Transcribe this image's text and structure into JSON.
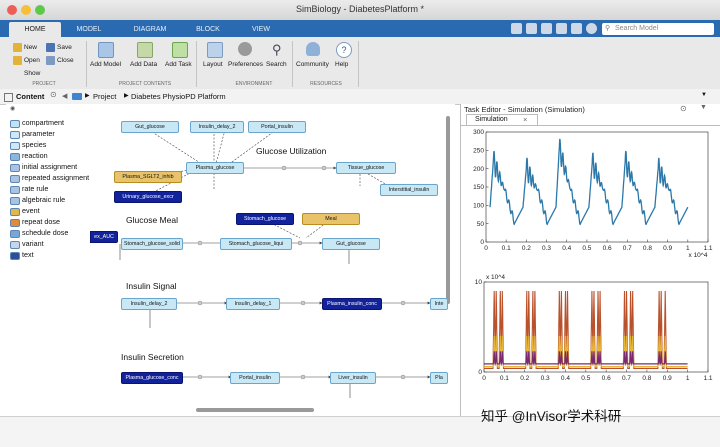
{
  "window": {
    "title": "SimBiology - DiabetesPlatform *"
  },
  "tabs": [
    {
      "label": "HOME",
      "active": true
    },
    {
      "label": "MODEL",
      "active": false
    },
    {
      "label": "DIAGRAM",
      "active": false
    },
    {
      "label": "BLOCK",
      "active": false
    },
    {
      "label": "VIEW",
      "active": false
    }
  ],
  "search": {
    "placeholder": "Search Model"
  },
  "toolstrip": {
    "project_buttons": [
      "New",
      "Save",
      "Open",
      "Close",
      "Show"
    ],
    "model_buttons": [
      "Add Model",
      "Add Data",
      "Add Task"
    ],
    "environment_buttons": [
      "Layout",
      "Preferences",
      "Search"
    ],
    "resources_buttons": [
      "Community",
      "Help"
    ],
    "groups": [
      "PROJECT",
      "PROJECT CONTENTS",
      "ENVIRONMENT",
      "RESOURCES"
    ]
  },
  "address": {
    "panel_title": "Content",
    "path": [
      "Project",
      "Diabetes PhysioPD Platform"
    ]
  },
  "library": {
    "items": [
      {
        "label": "compartment",
        "icon": "compartment-icon",
        "color": "#bfe3f3"
      },
      {
        "label": "parameter",
        "icon": "parameter-icon",
        "color": "#cfe8f7"
      },
      {
        "label": "species",
        "icon": "species-icon",
        "color": "#cfe8f7"
      },
      {
        "label": "reaction",
        "icon": "reaction-icon",
        "color": "#8ab7dd"
      },
      {
        "label": "initial assignment",
        "icon": "initial-assignment-icon",
        "color": "#a7c4e2"
      },
      {
        "label": "repeated assignment",
        "icon": "repeated-assignment-icon",
        "color": "#a7c4e2"
      },
      {
        "label": "rate rule",
        "icon": "rate-rule-icon",
        "color": "#a7c4e2"
      },
      {
        "label": "algebraic rule",
        "icon": "algebraic-rule-icon",
        "color": "#a7c4e2"
      },
      {
        "label": "event",
        "icon": "event-icon",
        "color": "#e0b84a"
      },
      {
        "label": "repeat dose",
        "icon": "repeat-dose-icon",
        "color": "#e08a3a"
      },
      {
        "label": "schedule dose",
        "icon": "schedule-dose-icon",
        "color": "#7ba6d4"
      },
      {
        "label": "variant",
        "icon": "variant-icon",
        "color": "#c6d6e8"
      },
      {
        "label": "text",
        "icon": "text-icon",
        "color": "#2a4f9a"
      }
    ]
  },
  "diagram": {
    "clusters": {
      "glucose_utilization": "Glucose Utilization",
      "glucose_meal": "Glucose Meal",
      "insulin_signal": "Insulin Signal",
      "insulin_secretion": "Insulin Secretion"
    },
    "nodes": {
      "gut_glucose_1": "Gut_glucose",
      "insulin_delay_2a": "Insulin_delay_2",
      "portal_insulin_1": "Portal_insulin",
      "plasma_glucose_1": "Plasma_glucose",
      "plasma_sglt2": "Plasma_SGLT2_inhib",
      "urinary_glucose": "Urinary_glucose_excr",
      "tissue_glucose": "Tissue_glucose",
      "interstitial_insulin": "Interstitial_insulin",
      "stomach_glucose": "Stomach_glucose",
      "meal": "Meal",
      "ex_auc": "ex_AUC",
      "stomach_solid": "Stomach_glucose_solid",
      "stomach_liquid": "Stomach_glucose_liqui",
      "gut_glucose_2": "Gut_glucose",
      "insulin_delay_2b": "Insulin_delay_2",
      "insulin_delay_1": "Insulin_delay_1",
      "plasma_insulin_conc": "Plasma_insulin_conc",
      "inte": "Inte",
      "plasma_glucose_conc": "Plasma_glucose_conc",
      "portal_insulin_2": "Portal_insulin",
      "liver_insulin": "Liver_insulin",
      "pla": "Pla"
    }
  },
  "task_editor": {
    "title": "Task Editor - Simulation (Simulation)",
    "tab": "Simulation"
  },
  "chart_data": [
    {
      "type": "line",
      "xlim": [
        0,
        1.1
      ],
      "x_multiplier": "x 10^4",
      "ylim": [
        0,
        300
      ],
      "xticks": [
        "0",
        "0.1",
        "0.2",
        "0.3",
        "0.4",
        "0.5",
        "0.6",
        "0.7",
        "0.8",
        "0.9",
        "1",
        "1.1"
      ],
      "yticks": [
        "0",
        "50",
        "100",
        "150",
        "200",
        "250",
        "300"
      ],
      "series": [
        {
          "color": "#2b78a9",
          "cycles": 6,
          "x_start": 0.02,
          "x_end": 1.0,
          "baseline": 95,
          "trough": 52,
          "peaks": [
            220,
            200,
            255,
            215
          ]
        }
      ]
    },
    {
      "type": "line",
      "xlim": [
        0,
        1.1
      ],
      "ylim": [
        0,
        10
      ],
      "y_multiplier": "x 10^4",
      "xticks": [
        "0",
        "0.1",
        "0.2",
        "0.3",
        "0.4",
        "0.5",
        "0.6",
        "0.7",
        "0.8",
        "0.9",
        "1",
        "1.1"
      ],
      "yticks": [
        "0",
        "10"
      ],
      "series": [
        {
          "color": "#b9512a",
          "spikes": [
            0.05,
            0.06,
            0.08,
            0.09,
            0.21,
            0.22,
            0.24,
            0.25,
            0.37,
            0.38,
            0.4,
            0.41,
            0.53,
            0.54,
            0.56,
            0.57,
            0.69,
            0.7,
            0.72,
            0.73,
            0.86,
            0.87,
            0.89
          ],
          "peak": 9.0,
          "base": 0.4
        },
        {
          "color": "#e7b43a",
          "spikes": [
            0.05,
            0.06,
            0.08,
            0.09,
            0.21,
            0.22,
            0.24,
            0.25,
            0.37,
            0.38,
            0.4,
            0.41,
            0.53,
            0.54,
            0.56,
            0.57,
            0.69,
            0.7,
            0.72,
            0.73,
            0.86,
            0.87,
            0.89
          ],
          "peak": 4.0,
          "base": 0.6
        },
        {
          "color": "#7a2a6e",
          "spikes": [
            0.05,
            0.06,
            0.08,
            0.09,
            0.21,
            0.22,
            0.24,
            0.25,
            0.37,
            0.38,
            0.4,
            0.41,
            0.53,
            0.54,
            0.56,
            0.57,
            0.69,
            0.7,
            0.72,
            0.73,
            0.86,
            0.87,
            0.89
          ],
          "peak": 2.3,
          "base": 0.9
        }
      ]
    }
  ],
  "watermark": "知乎 @InVisor学术科研"
}
